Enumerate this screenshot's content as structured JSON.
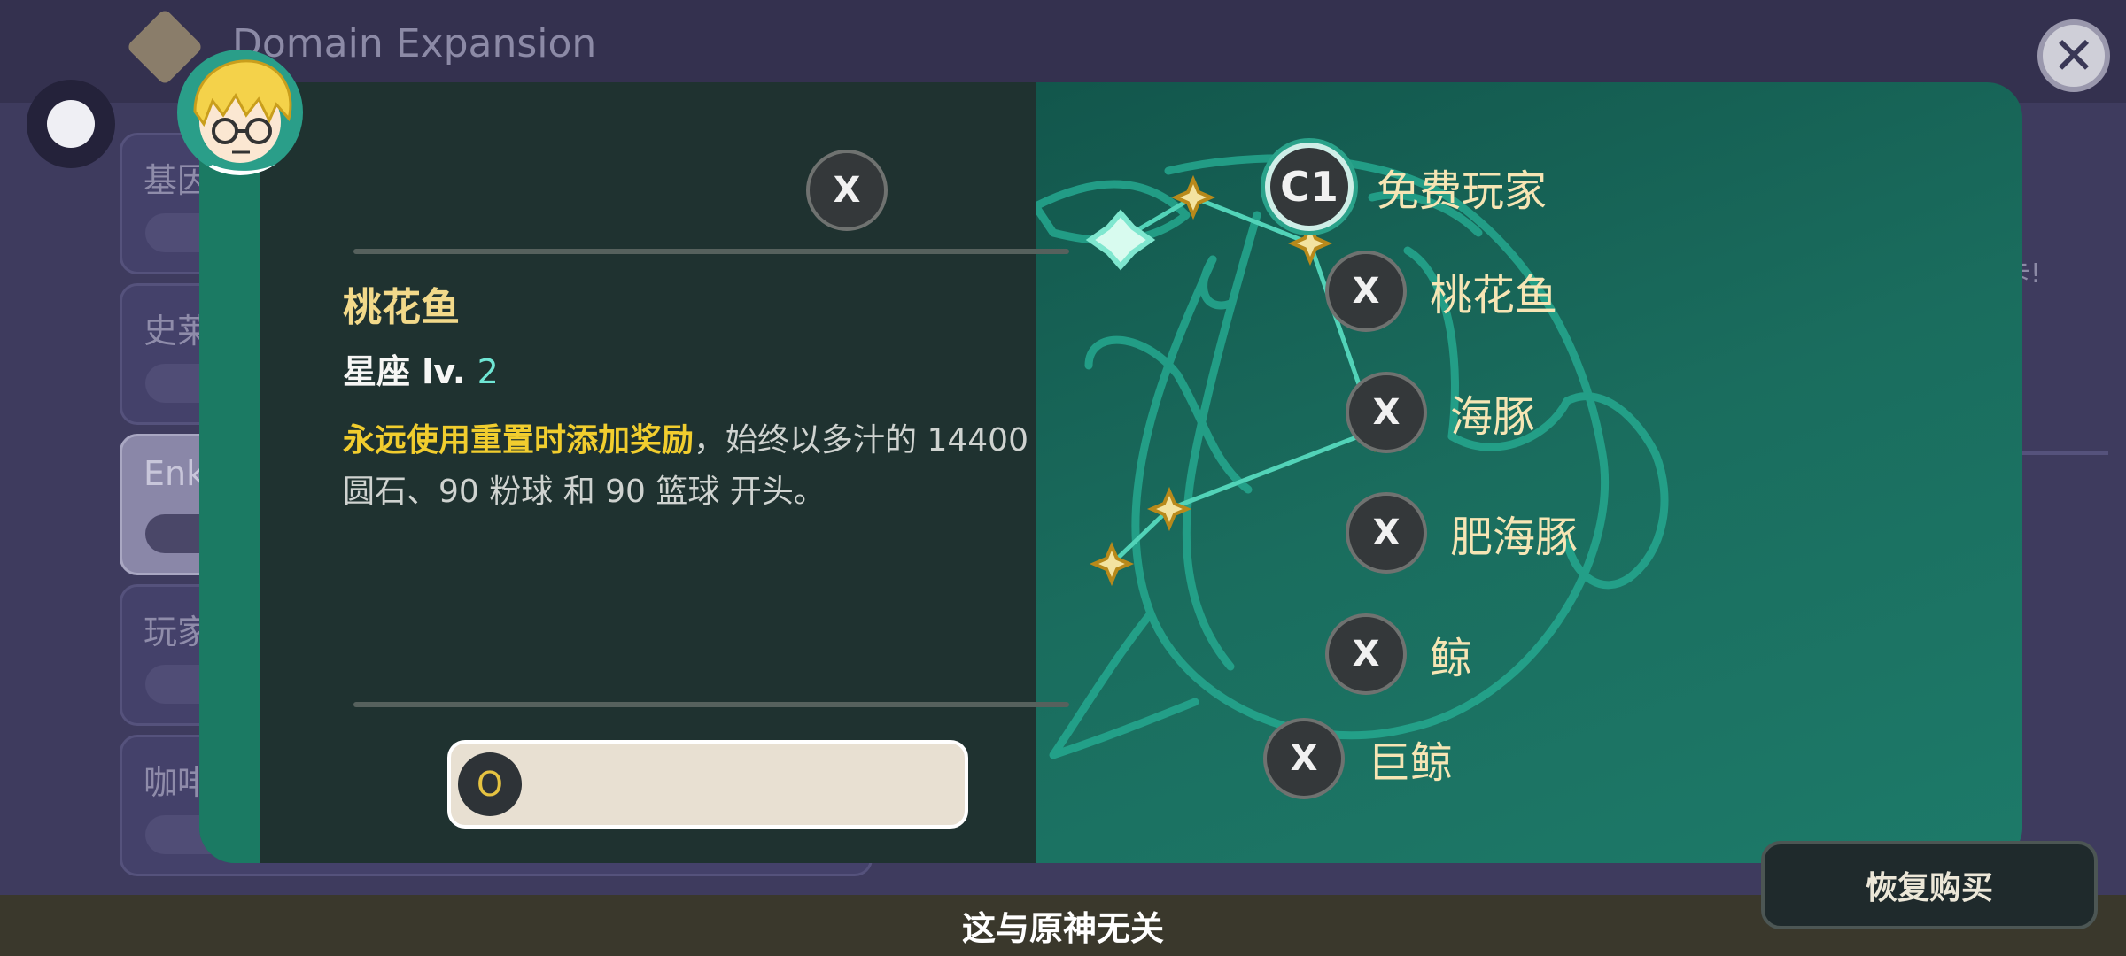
{
  "background": {
    "title": "Domain Expansion",
    "cards": [
      {
        "label": "基因"
      },
      {
        "label": "史莱"
      },
      {
        "label": "Enk"
      },
      {
        "label": "玩家"
      },
      {
        "label": "咖啡"
      }
    ],
    "right_fragment": "卡!"
  },
  "modal": {
    "close_button_label": "X",
    "detail": {
      "name": "桃花鱼",
      "level_prefix": "星座 lv.",
      "level_value": "2",
      "desc_highlight": "永远使用重置时添加奖励",
      "desc_rest": "，始终以多汁的 14400 圆石、90 粉球 和 90 篮球 开头。",
      "bar_badge": "O"
    },
    "constellation_list": [
      {
        "badge": "C1",
        "label": "免费玩家"
      },
      {
        "badge": "X",
        "label": "桃花鱼"
      },
      {
        "badge": "X",
        "label": "海豚"
      },
      {
        "badge": "X",
        "label": "肥海豚"
      },
      {
        "badge": "X",
        "label": "鲸"
      },
      {
        "badge": "X",
        "label": "巨鲸"
      }
    ]
  },
  "footer": {
    "subtitle": "这与原神无关",
    "restore_purchase": "恢复购买"
  },
  "colors": {
    "accent": "#2aa28a",
    "gold": "#f1cd2e",
    "panel": "#1f3230"
  }
}
